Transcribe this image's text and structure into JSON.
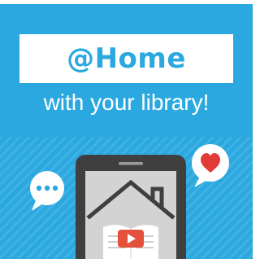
{
  "banner": {
    "title": "@Home"
  },
  "subtitle": "with your library!",
  "icons": {
    "chat_bubble": "chat-bubble-icon",
    "heart_bubble": "heart-bubble-icon",
    "house": "house-outline-icon",
    "book": "open-book-icon",
    "play": "play-button-icon"
  },
  "colors": {
    "background": "#2aa8df",
    "phone": "#3f3f3f",
    "screen": "#d3d3d3",
    "heart": "#e23b36",
    "play": "#e3503c"
  }
}
